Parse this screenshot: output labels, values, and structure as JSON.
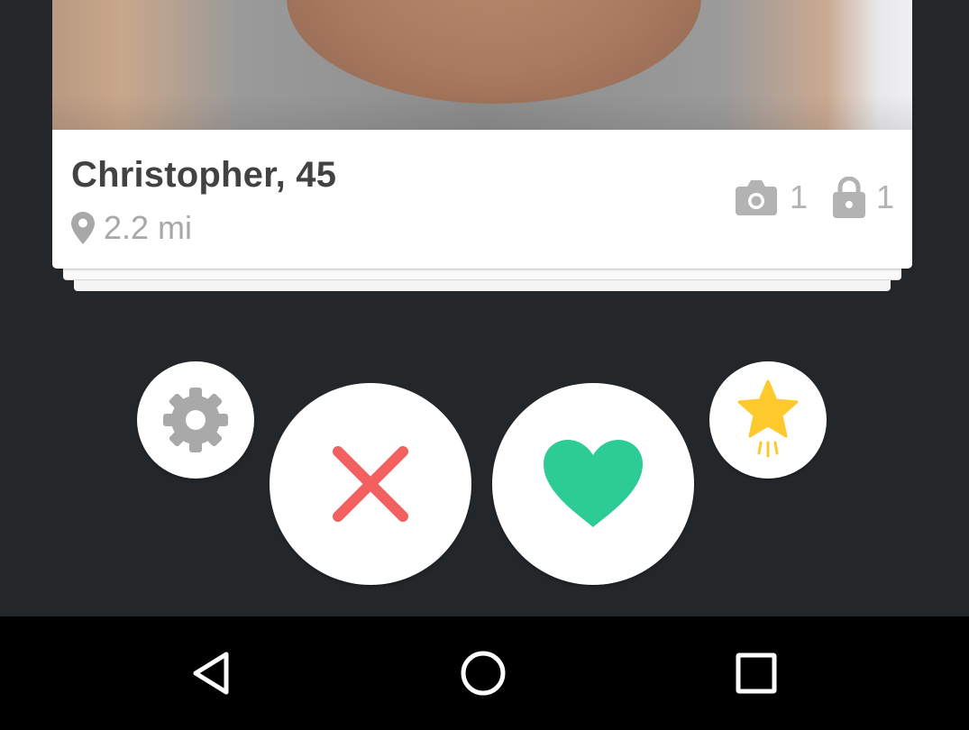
{
  "profile": {
    "name_age": "Christopher, 45",
    "distance": "2.2 mi",
    "photo_count": "1",
    "private_photo_count": "1"
  },
  "actions": {
    "settings_icon": "gear-icon",
    "nope_icon": "x-icon",
    "like_icon": "heart-icon",
    "superlike_icon": "star-icon"
  },
  "colors": {
    "background": "#24272a",
    "nope": "#f2605f",
    "like": "#2ecc95",
    "superlike": "#fdc92c",
    "settings": "#a9a9a9"
  },
  "navigation": {
    "back_icon": "back-triangle-icon",
    "home_icon": "home-circle-icon",
    "recents_icon": "recents-square-icon"
  }
}
